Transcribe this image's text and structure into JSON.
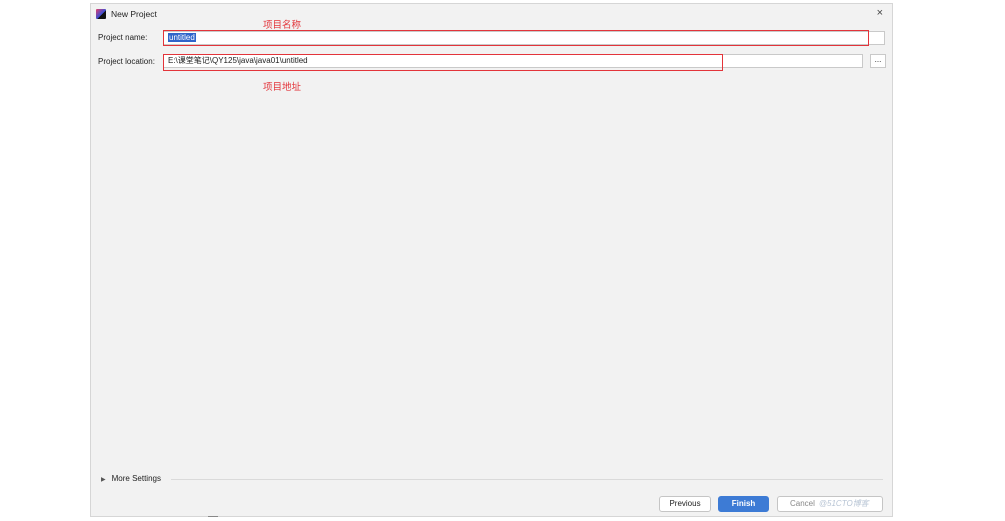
{
  "window": {
    "title": "New Project",
    "close_glyph": "×",
    "icon": "intellij-app-icon"
  },
  "form": {
    "name_label": "Project name:",
    "name_value": "untitled",
    "location_label": "Project location:",
    "location_value": "E:\\课堂笔记\\QY125\\java\\java01\\untitled",
    "browse_label": "..."
  },
  "annotations": {
    "name_note": "项目名称",
    "location_note": "项目地址",
    "color": "#e3343a"
  },
  "more_settings": {
    "label": "More Settings",
    "chevron": "▶"
  },
  "buttons": {
    "previous": "Previous",
    "finish": "Finish",
    "cancel": "Cancel",
    "watermark": "@51CTO博客"
  },
  "colors": {
    "accent": "#3d7bd5",
    "selection": "#2f65ca",
    "annotation": "#e3343a"
  }
}
